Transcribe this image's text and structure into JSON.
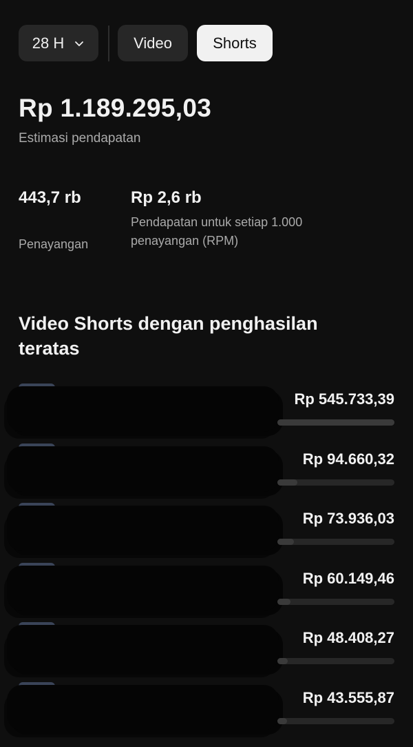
{
  "filters": {
    "period_label": "28 H",
    "tabs": [
      {
        "label": "Video",
        "selected": false
      },
      {
        "label": "Shorts",
        "selected": true
      }
    ]
  },
  "summary": {
    "total_revenue": "Rp 1.189.295,03",
    "total_label": "Estimasi pendapatan"
  },
  "metrics": {
    "views_value": "443,7 rb",
    "views_label": "Penayangan",
    "rpm_value": "Rp 2,6 rb",
    "rpm_label": "Pendapatan untuk setiap 1.000 penayangan (RPM)"
  },
  "top_shorts": {
    "title": "Video Shorts dengan penghasilan teratas",
    "items": [
      {
        "amount": "Rp 545.733,39",
        "share": 1.0
      },
      {
        "amount": "Rp 94.660,32",
        "share": 0.17
      },
      {
        "amount": "Rp 73.936,03",
        "share": 0.14
      },
      {
        "amount": "Rp 60.149,46",
        "share": 0.11
      },
      {
        "amount": "Rp 48.408,27",
        "share": 0.09
      },
      {
        "amount": "Rp 43.555,87",
        "share": 0.08
      }
    ]
  },
  "colors": {
    "background": "#0f0f0f",
    "chip_bg": "#272727",
    "chip_selected_bg": "#f1f1f1",
    "primary_text": "#f1f1f1",
    "secondary_text": "#aaaaaa"
  },
  "icons": {
    "period_dropdown": "chevron-down-icon"
  }
}
